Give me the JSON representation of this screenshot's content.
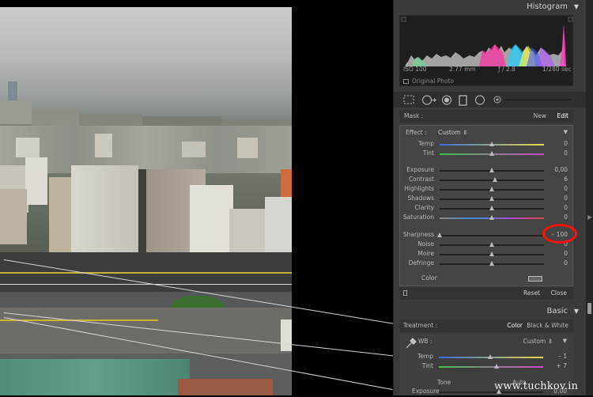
{
  "panels": {
    "histogram": "Histogram",
    "basic": "Basic"
  },
  "histogram_info": {
    "iso": "ISO 100",
    "focal": "2.77 mm",
    "aperture": "ƒ / 2.8",
    "shutter": "1/280 sec",
    "original_photo": "Original Photo"
  },
  "mask_bar": {
    "mask": "Mask :",
    "new": "New",
    "edit": "Edit"
  },
  "effect": {
    "label": "Effect :",
    "value": "Custom ⇕"
  },
  "sliders": [
    {
      "label": "Temp",
      "value": "0",
      "level": 0.5,
      "gradient": "linear-gradient(90deg,#3b6fd4,#e8d84a)"
    },
    {
      "label": "Tint",
      "value": "0",
      "level": 0.5,
      "gradient": "linear-gradient(90deg,#3fbf4a,#d048c8)"
    },
    {
      "label": "Exposure",
      "value": "0,00",
      "level": 0.5,
      "gradient": ""
    },
    {
      "label": "Contrast",
      "value": "6",
      "level": 0.53,
      "gradient": ""
    },
    {
      "label": "Highlights",
      "value": "0",
      "level": 0.5,
      "gradient": ""
    },
    {
      "label": "Shadows",
      "value": "0",
      "level": 0.5,
      "gradient": ""
    },
    {
      "label": "Clarity",
      "value": "0",
      "level": 0.5,
      "gradient": ""
    },
    {
      "label": "Saturation",
      "value": "0",
      "level": 0.5,
      "gradient": "linear-gradient(90deg,#888,#3e8dd6,#a84fd0,#e04a4a)"
    },
    {
      "label": "Sharpness",
      "value": "– 100",
      "level": 0.0,
      "gradient": ""
    },
    {
      "label": "Noise",
      "value": "0",
      "level": 0.5,
      "gradient": ""
    },
    {
      "label": "Moire",
      "value": "0",
      "level": 0.5,
      "gradient": ""
    },
    {
      "label": "Defringe",
      "value": "0",
      "level": 0.5,
      "gradient": ""
    }
  ],
  "color_row": {
    "label": "Color"
  },
  "reset_bar": {
    "reset": "Reset",
    "close": "Close"
  },
  "treatment": {
    "label": "Treatment :",
    "color": "Color",
    "bw": "Black & White"
  },
  "wb": {
    "label": "WB :",
    "value": "Custom ⇕"
  },
  "basic_sliders": [
    {
      "label": "Temp",
      "value": "– 1",
      "level": 0.49
    },
    {
      "label": "Tint",
      "value": "+ 7",
      "level": 0.55
    }
  ],
  "tone": {
    "label": "Tone",
    "auto": "Auto",
    "exposure": "Exposure",
    "exposure_value": "0,00"
  },
  "watermark": "www.tuchkov.in",
  "colors": {
    "panel": "#3a3a3a",
    "highlight_circle": "#ff1010"
  }
}
